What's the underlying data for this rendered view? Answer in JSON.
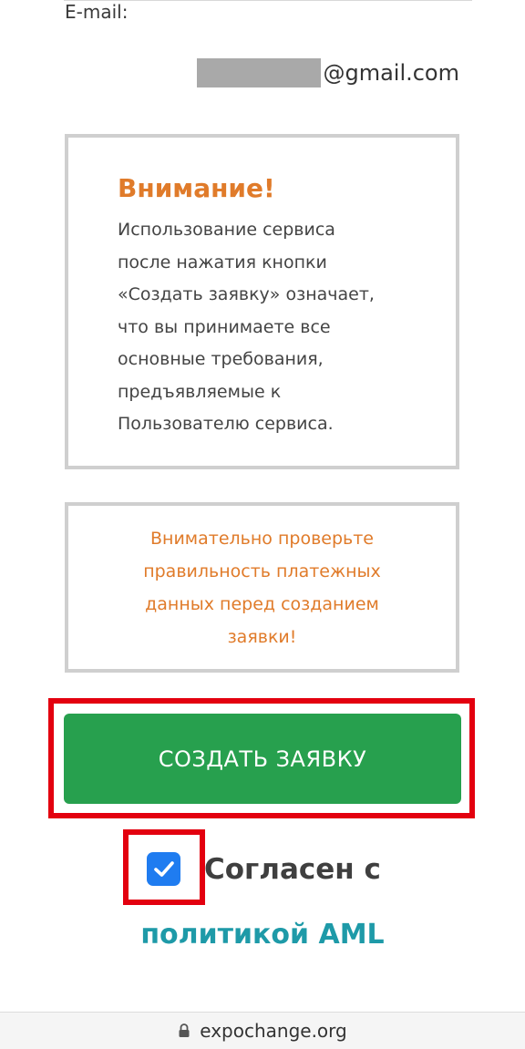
{
  "email": {
    "label": "E-mail:",
    "value_domain": "@gmail.com"
  },
  "notice": {
    "title": "Внимание!",
    "lines": [
      "Использование сервиса",
      "после нажатия кнопки",
      "«Создать заявку» означает,",
      "что вы принимаете все",
      "основные требования,",
      "предъявляемые к",
      "Пользователю сервиса."
    ]
  },
  "check_warning": {
    "lines": [
      "Внимательно проверьте",
      "правильность платежных",
      "данных перед созданием",
      "заявки!"
    ]
  },
  "actions": {
    "create_label": "СОЗДАТЬ ЗАЯВКУ"
  },
  "agreement": {
    "checked": true,
    "text": "Согласен с",
    "link_text": "политикой AML"
  },
  "browser": {
    "url": "expochange.org"
  },
  "colors": {
    "accent_orange": "#e07b2a",
    "button_green": "#27a04e",
    "highlight_red": "#e3000f",
    "checkbox_blue": "#1f7cf0",
    "link_teal": "#1e9aa8"
  }
}
